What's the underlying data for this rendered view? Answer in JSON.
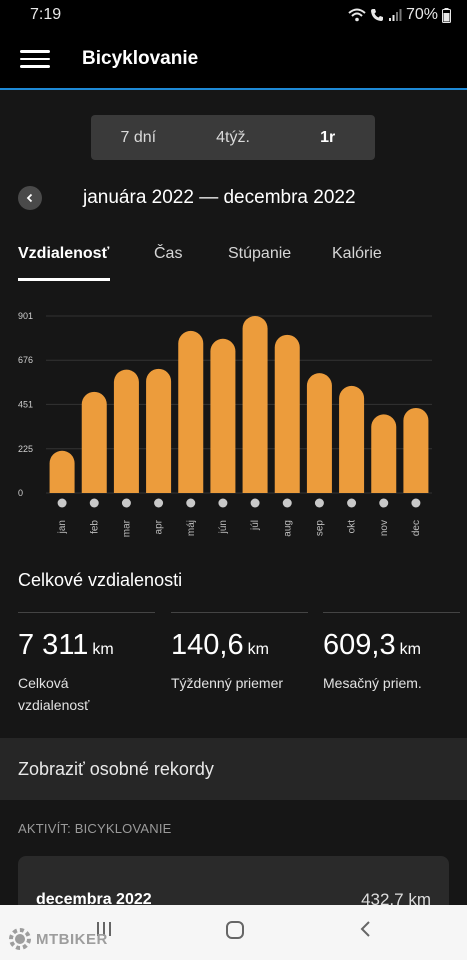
{
  "status_bar": {
    "time": "7:19",
    "battery": "70%"
  },
  "app_bar": {
    "title": "Bicyklovanie",
    "menu_icon": "hamburger-icon"
  },
  "period_tabs": [
    {
      "label": "7 dní",
      "active": false
    },
    {
      "label": "4týž.",
      "active": false
    },
    {
      "label": "1r",
      "active": true
    }
  ],
  "date_range": {
    "text": "januára 2022 — decembra 2022",
    "back_icon": "chevron-left-icon"
  },
  "metric_tabs": [
    {
      "label": "Vzdialenosť",
      "active": true
    },
    {
      "label": "Čas",
      "active": false
    },
    {
      "label": "Stúpanie",
      "active": false
    },
    {
      "label": "Kalórie",
      "active": false
    }
  ],
  "chart_data": {
    "type": "bar",
    "categories": [
      "jan",
      "feb",
      "mar",
      "apr",
      "máj",
      "jún",
      "júl",
      "aug",
      "sep",
      "okt",
      "nov",
      "dec"
    ],
    "values": [
      215,
      515,
      628,
      632,
      825,
      785,
      901,
      805,
      610,
      545,
      400,
      433
    ],
    "yticks": [
      "0",
      "225",
      "451",
      "676",
      "901"
    ],
    "ylim": [
      0,
      901
    ],
    "bar_color": "#ec9c3c",
    "grid": true
  },
  "summary": {
    "title": "Celkové vzdialenosti",
    "stats": [
      {
        "value": "7 311",
        "unit": "km",
        "label": "Celková vzdialenosť"
      },
      {
        "value": "140,6",
        "unit": "km",
        "label": "Týždenný priemer"
      },
      {
        "value": "609,3",
        "unit": "km",
        "label": "Mesačný priem."
      }
    ]
  },
  "records_button": "Zobraziť osobné rekordy",
  "activity_label": "AKTIVÍT: BICYKLOVANIE",
  "month_card": {
    "month": "decembra 2022",
    "value": "432,7 km"
  },
  "watermark": "MTBIKER",
  "accent_color": "#1e8ad6"
}
